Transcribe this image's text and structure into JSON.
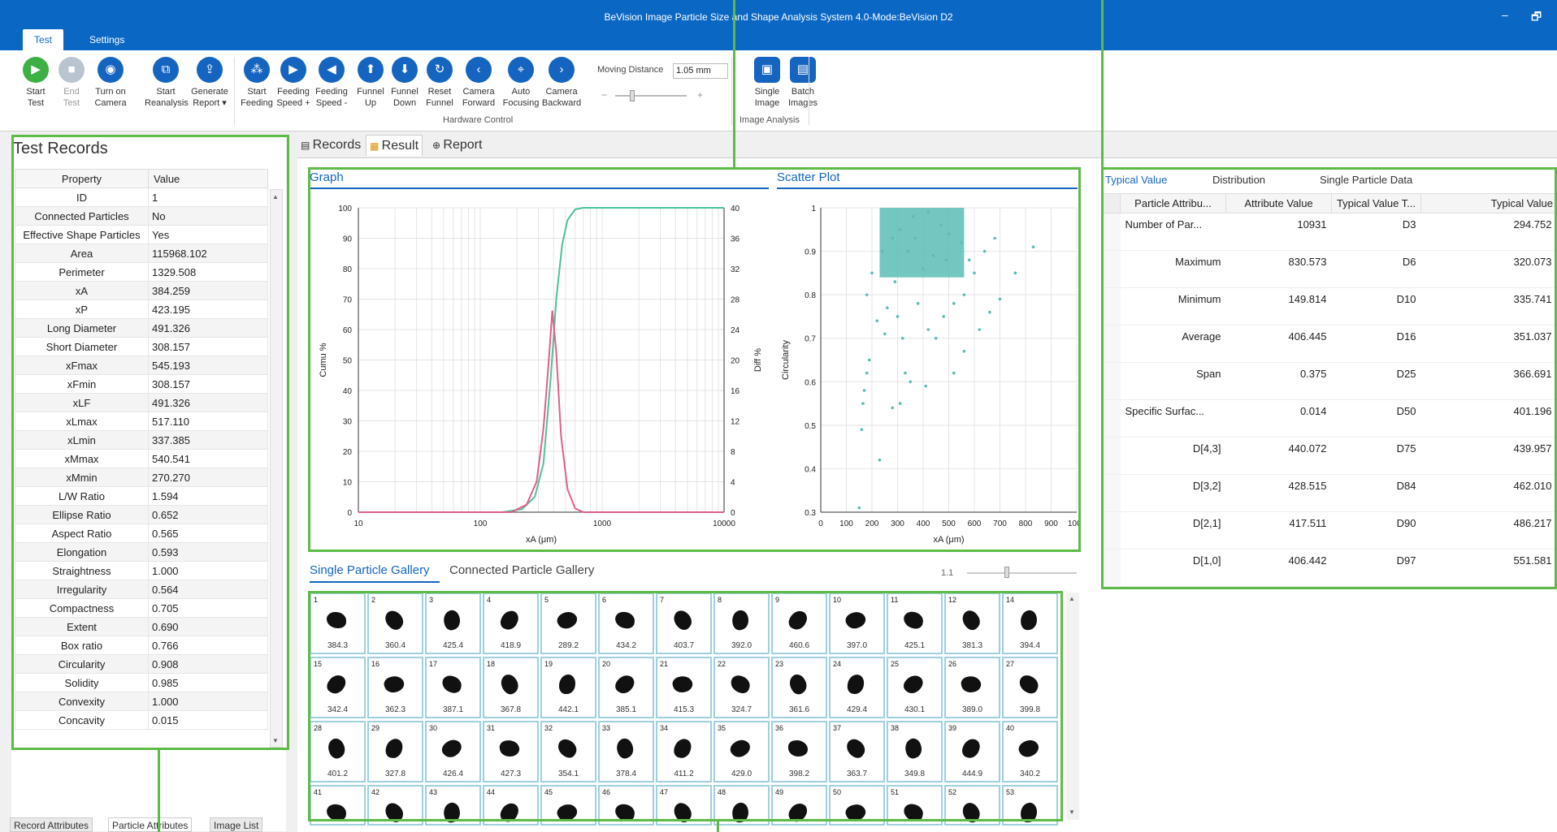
{
  "window": {
    "title": "BeVision Image Particle Size and Shape Analysis System 4.0-Mode:BeVision D2",
    "minimize": "–",
    "restore": "🗗"
  },
  "menu_tabs": [
    "Test",
    "Settings"
  ],
  "ribbon": {
    "buttons": [
      {
        "label1": "Start",
        "label2": "Test",
        "icon": "play-icon",
        "glyph": "▶"
      },
      {
        "label1": "End",
        "label2": "Test",
        "icon": "stop-icon",
        "glyph": "■"
      },
      {
        "label1": "Turn on",
        "label2": "Camera",
        "icon": "camera-icon",
        "glyph": "◉"
      },
      {
        "label1": "Start",
        "label2": "Reanalysis",
        "icon": "reanalysis-icon",
        "glyph": "⧉"
      },
      {
        "label1": "Generate",
        "label2": "Report ▾",
        "icon": "report-icon",
        "glyph": "⇪"
      },
      {
        "label1": "Start",
        "label2": "Feeding",
        "icon": "feeding-icon",
        "glyph": "⁂"
      },
      {
        "label1": "Feeding",
        "label2": "Speed +",
        "icon": "speed-up-icon",
        "glyph": "▶"
      },
      {
        "label1": "Feeding",
        "label2": "Speed -",
        "icon": "speed-down-icon",
        "glyph": "◀"
      },
      {
        "label1": "Funnel",
        "label2": "Up",
        "icon": "arrow-up-icon",
        "glyph": "⬆"
      },
      {
        "label1": "Funnel",
        "label2": "Down",
        "icon": "arrow-down-icon",
        "glyph": "⬇"
      },
      {
        "label1": "Reset",
        "label2": "Funnel",
        "icon": "reset-icon",
        "glyph": "↻"
      },
      {
        "label1": "Camera",
        "label2": "Forward",
        "icon": "chevron-left-icon",
        "glyph": "‹"
      },
      {
        "label1": "Auto",
        "label2": "Focusing",
        "icon": "focus-icon",
        "glyph": "⌖"
      },
      {
        "label1": "Camera",
        "label2": "Backward",
        "icon": "chevron-right-icon",
        "glyph": "›"
      },
      {
        "label1": "Single",
        "label2": "Image",
        "icon": "single-image-icon",
        "glyph": "▣"
      },
      {
        "label1": "Batch",
        "label2": "Images",
        "icon": "batch-images-icon",
        "glyph": "▤"
      }
    ],
    "moving_distance_label": "Moving Distance",
    "moving_distance_value": "1.05 mm",
    "minus": "−",
    "plus": "+",
    "group_hardware": "Hardware Control",
    "group_image": "Image Analysis"
  },
  "left": {
    "title": "Test Records",
    "headers": [
      "Property",
      "Value"
    ],
    "rows": [
      [
        "ID",
        "1"
      ],
      [
        "Connected Particles",
        "No"
      ],
      [
        "Effective Shape Particles",
        "Yes"
      ],
      [
        "Area",
        "115968.102"
      ],
      [
        "Perimeter",
        "1329.508"
      ],
      [
        "xA",
        "384.259"
      ],
      [
        "xP",
        "423.195"
      ],
      [
        "Long Diameter",
        "491.326"
      ],
      [
        "Short Diameter",
        "308.157"
      ],
      [
        "xFmax",
        "545.193"
      ],
      [
        "xFmin",
        "308.157"
      ],
      [
        "xLF",
        "491.326"
      ],
      [
        "xLmax",
        "517.110"
      ],
      [
        "xLmin",
        "337.385"
      ],
      [
        "xMmax",
        "540.541"
      ],
      [
        "xMmin",
        "270.270"
      ],
      [
        "L/W Ratio",
        "1.594"
      ],
      [
        "Ellipse Ratio",
        "0.652"
      ],
      [
        "Aspect Ratio",
        "0.565"
      ],
      [
        "Elongation",
        "0.593"
      ],
      [
        "Straightness",
        "1.000"
      ],
      [
        "Irregularity",
        "0.564"
      ],
      [
        "Compactness",
        "0.705"
      ],
      [
        "Extent",
        "0.690"
      ],
      [
        "Box ratio",
        "0.766"
      ],
      [
        "Circularity",
        "0.908"
      ],
      [
        "Solidity",
        "0.985"
      ],
      [
        "Convexity",
        "1.000"
      ],
      [
        "Concavity",
        "0.015"
      ]
    ],
    "bottom_tabs": [
      "Record Attributes",
      "Particle Attributes",
      "Image List"
    ]
  },
  "main_tabs": [
    "Records",
    "Result",
    "Report"
  ],
  "graph": {
    "title": "Graph"
  },
  "scatter": {
    "title": "Scatter Plot"
  },
  "chart_data": [
    {
      "type": "line",
      "title": "Graph",
      "xlabel": "xA (μm)",
      "ylabel": "Cumu %",
      "y2label": "Diff %",
      "xscale": "log",
      "xlim": [
        10,
        10000
      ],
      "ylim": [
        0,
        100
      ],
      "y2lim": [
        0,
        40
      ],
      "xticks": [
        "10",
        "100",
        "1000",
        "10000"
      ],
      "yticks": [
        "0",
        "10",
        "20",
        "30",
        "40",
        "50",
        "60",
        "70",
        "80",
        "90",
        "100"
      ],
      "y2ticks": [
        "0",
        "4",
        "8",
        "12",
        "16",
        "20",
        "24",
        "28",
        "32",
        "36",
        "40"
      ],
      "series": [
        {
          "axis": "left",
          "color": "#4cc1a0",
          "x": [
            10,
            150,
            220,
            280,
            330,
            380,
            420,
            470,
            520,
            600,
            700,
            1000,
            10000
          ],
          "y": [
            0,
            0,
            1,
            5,
            16,
            45,
            70,
            88,
            96,
            99.5,
            100,
            100,
            100
          ]
        },
        {
          "axis": "right",
          "color": "#e0608a",
          "x": [
            10,
            180,
            240,
            290,
            330,
            365,
            390,
            420,
            460,
            520,
            600,
            700,
            10000
          ],
          "y": [
            0,
            0,
            1,
            4,
            11,
            20,
            26.5,
            21,
            10,
            3,
            0.5,
            0,
            0
          ]
        }
      ]
    },
    {
      "type": "scatter",
      "title": "Scatter Plot",
      "xlabel": "xA (μm)",
      "ylabel": "Circularity",
      "xlim": [
        0,
        1000
      ],
      "ylim": [
        0.3,
        1
      ],
      "xticks": [
        "0",
        "100",
        "200",
        "300",
        "400",
        "500",
        "600",
        "700",
        "800",
        "900",
        "1000"
      ],
      "yticks": [
        "0.3",
        "0.4",
        "0.5",
        "0.6",
        "0.7",
        "0.8",
        "0.9",
        "1"
      ],
      "color": "#5bbdb5",
      "points": [
        [
          150,
          0.31
        ],
        [
          160,
          0.49
        ],
        [
          165,
          0.55
        ],
        [
          170,
          0.58
        ],
        [
          180,
          0.62
        ],
        [
          190,
          0.65
        ],
        [
          230,
          0.42
        ],
        [
          280,
          0.54
        ],
        [
          310,
          0.55
        ],
        [
          330,
          0.62
        ],
        [
          350,
          0.6
        ],
        [
          410,
          0.59
        ],
        [
          520,
          0.62
        ],
        [
          560,
          0.67
        ],
        [
          620,
          0.72
        ],
        [
          660,
          0.76
        ],
        [
          700,
          0.79
        ],
        [
          760,
          0.85
        ],
        [
          830,
          0.91
        ],
        [
          180,
          0.8
        ],
        [
          200,
          0.85
        ],
        [
          220,
          0.74
        ],
        [
          250,
          0.71
        ],
        [
          260,
          0.77
        ],
        [
          290,
          0.83
        ],
        [
          320,
          0.7
        ],
        [
          300,
          0.75
        ],
        [
          240,
          0.9
        ],
        [
          280,
          0.93
        ],
        [
          310,
          0.95
        ],
        [
          360,
          0.98
        ],
        [
          420,
          0.99
        ],
        [
          470,
          0.96
        ],
        [
          500,
          0.94
        ],
        [
          550,
          0.92
        ],
        [
          580,
          0.88
        ],
        [
          600,
          0.85
        ],
        [
          640,
          0.9
        ],
        [
          680,
          0.93
        ],
        [
          380,
          0.78
        ],
        [
          420,
          0.72
        ],
        [
          450,
          0.7
        ],
        [
          480,
          0.75
        ],
        [
          520,
          0.78
        ],
        [
          560,
          0.8
        ],
        [
          400,
          0.86
        ],
        [
          440,
          0.89
        ],
        [
          490,
          0.88
        ],
        [
          340,
          0.9
        ],
        [
          370,
          0.93
        ]
      ]
    }
  ],
  "gallery": {
    "tabs": [
      "Single Particle Gallery",
      "Connected Particle Gallery"
    ],
    "zoom": "1.1",
    "cells": [
      {
        "n": "1",
        "v": "384.3"
      },
      {
        "n": "2",
        "v": "360.4"
      },
      {
        "n": "3",
        "v": "425.4"
      },
      {
        "n": "4",
        "v": "418.9"
      },
      {
        "n": "5",
        "v": "289.2"
      },
      {
        "n": "6",
        "v": "434.2"
      },
      {
        "n": "7",
        "v": "403.7"
      },
      {
        "n": "8",
        "v": "392.0"
      },
      {
        "n": "9",
        "v": "460.6"
      },
      {
        "n": "10",
        "v": "397.0"
      },
      {
        "n": "11",
        "v": "425.1"
      },
      {
        "n": "12",
        "v": "381.3"
      },
      {
        "n": "14",
        "v": "394.4"
      },
      {
        "n": "15",
        "v": "342.4"
      },
      {
        "n": "16",
        "v": "362.3"
      },
      {
        "n": "17",
        "v": "387.1"
      },
      {
        "n": "18",
        "v": "367.8"
      },
      {
        "n": "19",
        "v": "442.1"
      },
      {
        "n": "20",
        "v": "385.1"
      },
      {
        "n": "21",
        "v": "415.3"
      },
      {
        "n": "22",
        "v": "324.7"
      },
      {
        "n": "23",
        "v": "361.6"
      },
      {
        "n": "24",
        "v": "429.4"
      },
      {
        "n": "25",
        "v": "430.1"
      },
      {
        "n": "26",
        "v": "389.0"
      },
      {
        "n": "27",
        "v": "399.8"
      },
      {
        "n": "28",
        "v": "401.2"
      },
      {
        "n": "29",
        "v": "327.8"
      },
      {
        "n": "30",
        "v": "426.4"
      },
      {
        "n": "31",
        "v": "427.3"
      },
      {
        "n": "32",
        "v": "354.1"
      },
      {
        "n": "33",
        "v": "378.4"
      },
      {
        "n": "34",
        "v": "411.2"
      },
      {
        "n": "35",
        "v": "429.0"
      },
      {
        "n": "36",
        "v": "398.2"
      },
      {
        "n": "37",
        "v": "363.7"
      },
      {
        "n": "38",
        "v": "349.8"
      },
      {
        "n": "39",
        "v": "444.9"
      },
      {
        "n": "40",
        "v": "340.2"
      },
      {
        "n": "41",
        "v": ""
      },
      {
        "n": "42",
        "v": ""
      },
      {
        "n": "43",
        "v": ""
      },
      {
        "n": "44",
        "v": ""
      },
      {
        "n": "45",
        "v": ""
      },
      {
        "n": "46",
        "v": ""
      },
      {
        "n": "47",
        "v": ""
      },
      {
        "n": "48",
        "v": ""
      },
      {
        "n": "49",
        "v": ""
      },
      {
        "n": "50",
        "v": ""
      },
      {
        "n": "51",
        "v": ""
      },
      {
        "n": "52",
        "v": ""
      },
      {
        "n": "53",
        "v": ""
      }
    ]
  },
  "right": {
    "tabs": [
      "Typical Value",
      "Distribution",
      "Single Particle Data"
    ],
    "headers": [
      "Particle Attribu...",
      "Attribute Value",
      "Typical Value T...",
      "Typical Value"
    ],
    "rows": [
      [
        "Number of Par...",
        "10931",
        "D3",
        "294.752"
      ],
      [
        "Maximum",
        "830.573",
        "D6",
        "320.073"
      ],
      [
        "Minimum",
        "149.814",
        "D10",
        "335.741"
      ],
      [
        "Average",
        "406.445",
        "D16",
        "351.037"
      ],
      [
        "Span",
        "0.375",
        "D25",
        "366.691"
      ],
      [
        "Specific Surfac...",
        "0.014",
        "D50",
        "401.196"
      ],
      [
        "D[4,3]",
        "440.072",
        "D75",
        "439.957"
      ],
      [
        "D[3,2]",
        "428.515",
        "D84",
        "462.010"
      ],
      [
        "D[2,1]",
        "417.511",
        "D90",
        "486.217"
      ],
      [
        "D[1,0]",
        "406.442",
        "D97",
        "551.581"
      ]
    ]
  }
}
